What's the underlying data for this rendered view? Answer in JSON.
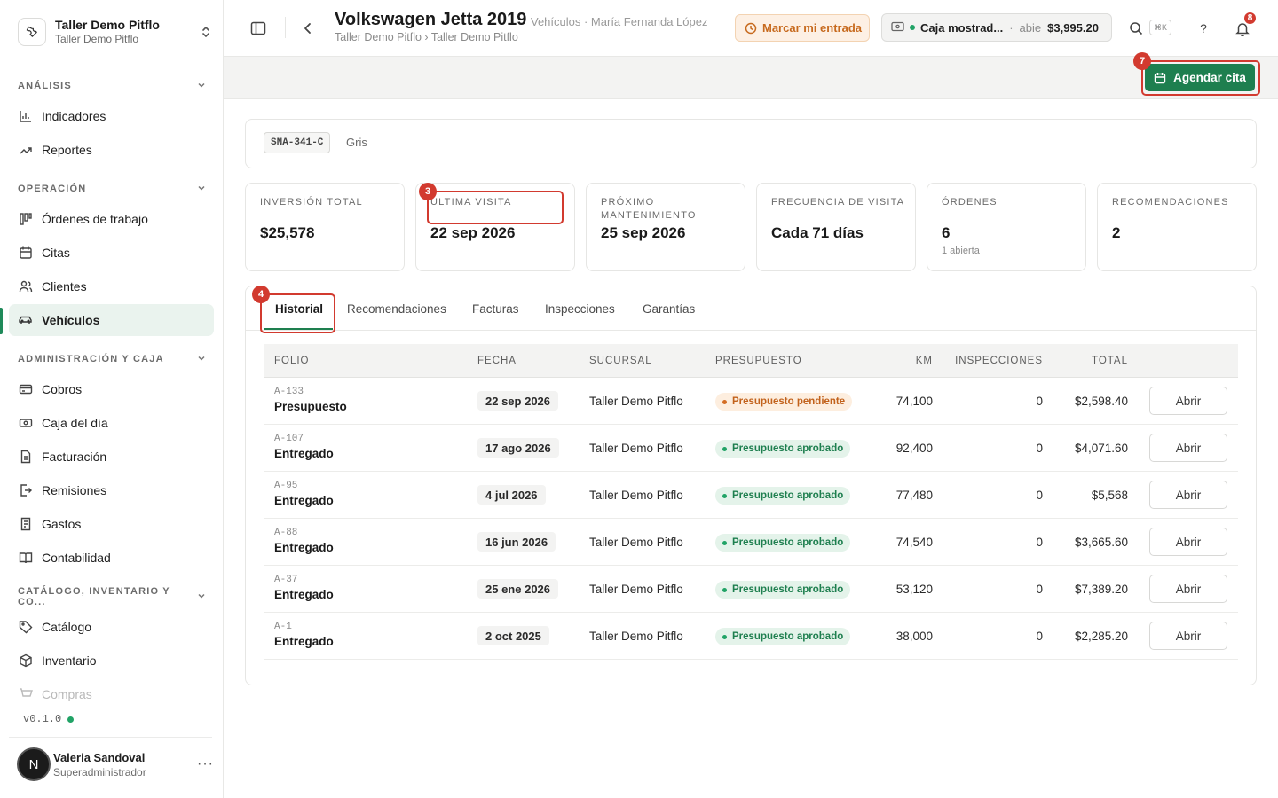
{
  "brand": {
    "title": "Taller Demo Pitflo",
    "subtitle": "Taller Demo Pitflo"
  },
  "sidebar": {
    "sections": [
      {
        "label": "ANÁLISIS"
      },
      {
        "label": "OPERACIÓN"
      },
      {
        "label": "ADMINISTRACIÓN Y CAJA"
      },
      {
        "label": "CATÁLOGO, INVENTARIO Y CO..."
      }
    ],
    "items": [
      {
        "label": "Indicadores",
        "icon": "bar-chart-icon"
      },
      {
        "label": "Reportes",
        "icon": "trend-icon"
      },
      {
        "label": "Órdenes de trabajo",
        "icon": "kanban-icon"
      },
      {
        "label": "Citas",
        "icon": "calendar-icon"
      },
      {
        "label": "Clientes",
        "icon": "users-icon"
      },
      {
        "label": "Vehículos",
        "icon": "car-icon",
        "active": true
      },
      {
        "label": "Cobros",
        "icon": "card-icon"
      },
      {
        "label": "Caja del día",
        "icon": "cash-icon"
      },
      {
        "label": "Facturación",
        "icon": "document-icon"
      },
      {
        "label": "Remisiones",
        "icon": "export-icon"
      },
      {
        "label": "Gastos",
        "icon": "receipt-icon"
      },
      {
        "label": "Contabilidad",
        "icon": "book-icon"
      },
      {
        "label": "Catálogo",
        "icon": "tag-icon"
      },
      {
        "label": "Inventario",
        "icon": "box-icon"
      },
      {
        "label": "Compras",
        "icon": "cart-icon"
      }
    ],
    "version": "v0.1.0",
    "user": {
      "initial": "N",
      "name": "Valeria Sandoval",
      "role": "Superadministrador",
      "more": "···"
    }
  },
  "header": {
    "title": "Volkswagen Jetta 2019",
    "meta": "Vehículos · María Fernanda López",
    "breadcrumb": "Taller Demo Pitflo › Taller Demo Pitflo",
    "clock_in_label": "Marcar mi entrada",
    "cash": {
      "name": "Caja mostrad...",
      "separator": "·",
      "status": "abie",
      "amount": "$3,995.20"
    },
    "shortcut": "⌘K",
    "help": "?",
    "notifications": "8"
  },
  "action": {
    "schedule_label": "Agendar cita"
  },
  "annotations": {
    "m3": "3",
    "m4": "4",
    "m7": "7"
  },
  "vehicle": {
    "plate": "SNA-341-C",
    "color": "Gris"
  },
  "stats": [
    {
      "label": "INVERSIÓN TOTAL",
      "value": "$25,578"
    },
    {
      "label": "ÚLTIMA VISITA",
      "value": "22 sep 2026"
    },
    {
      "label": "PRÓXIMO MANTENIMIENTO",
      "value": "25 sep 2026"
    },
    {
      "label": "FRECUENCIA DE VISITA",
      "value": "Cada 71 días"
    },
    {
      "label": "ÓRDENES",
      "value": "6",
      "sub": "1 abierta"
    },
    {
      "label": "RECOMENDACIONES",
      "value": "2"
    }
  ],
  "tabs": [
    "Historial",
    "Recomendaciones",
    "Facturas",
    "Inspecciones",
    "Garantías"
  ],
  "table": {
    "headers": [
      "FOLIO",
      "FECHA",
      "SUCURSAL",
      "PRESUPUESTO",
      "KM",
      "INSPECCIONES",
      "TOTAL"
    ],
    "open_label": "Abrir",
    "rows": [
      {
        "code": "A-133",
        "status": "Presupuesto",
        "date": "22 sep 2026",
        "branch": "Taller Demo Pitflo",
        "budget": "Presupuesto pendiente",
        "budget_state": "pending",
        "km": "74,100",
        "inspections": "0",
        "total": "$2,598.40"
      },
      {
        "code": "A-107",
        "status": "Entregado",
        "date": "17 ago 2026",
        "branch": "Taller Demo Pitflo",
        "budget": "Presupuesto aprobado",
        "budget_state": "approved",
        "km": "92,400",
        "inspections": "0",
        "total": "$4,071.60"
      },
      {
        "code": "A-95",
        "status": "Entregado",
        "date": "4 jul 2026",
        "branch": "Taller Demo Pitflo",
        "budget": "Presupuesto aprobado",
        "budget_state": "approved",
        "km": "77,480",
        "inspections": "0",
        "total": "$5,568"
      },
      {
        "code": "A-88",
        "status": "Entregado",
        "date": "16 jun 2026",
        "branch": "Taller Demo Pitflo",
        "budget": "Presupuesto aprobado",
        "budget_state": "approved",
        "km": "74,540",
        "inspections": "0",
        "total": "$3,665.60"
      },
      {
        "code": "A-37",
        "status": "Entregado",
        "date": "25 ene 2026",
        "branch": "Taller Demo Pitflo",
        "budget": "Presupuesto aprobado",
        "budget_state": "approved",
        "km": "53,120",
        "inspections": "0",
        "total": "$7,389.20"
      },
      {
        "code": "A-1",
        "status": "Entregado",
        "date": "2 oct 2025",
        "branch": "Taller Demo Pitflo",
        "budget": "Presupuesto aprobado",
        "budget_state": "approved",
        "km": "38,000",
        "inspections": "0",
        "total": "$2,285.20"
      }
    ]
  },
  "colors": {
    "accent": "#1e7f4f",
    "annotation": "#d23a2f",
    "warning": "#c76a1e"
  }
}
